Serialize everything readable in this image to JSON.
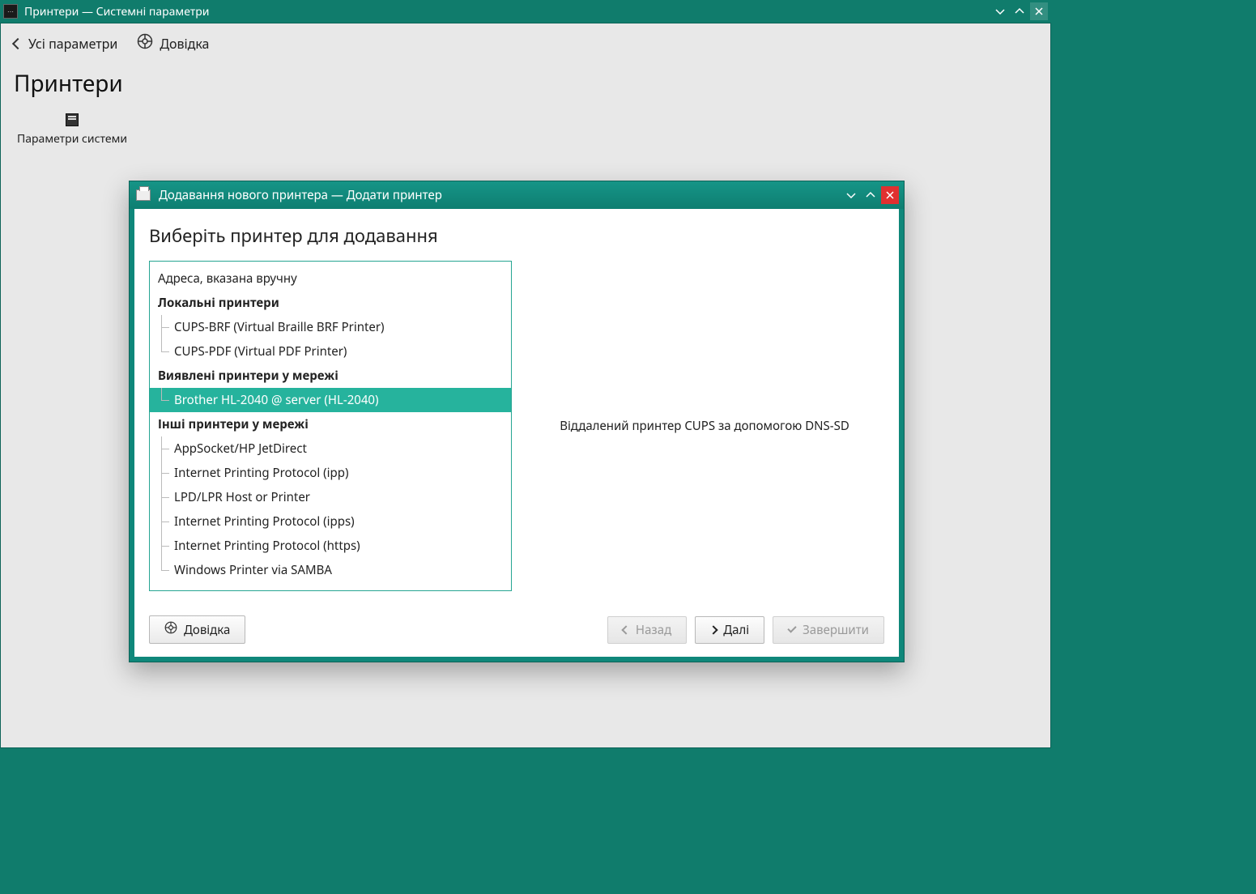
{
  "main_window": {
    "title": "Принтери — Системні параметри"
  },
  "toolbar": {
    "back_label": "Усі параметри",
    "help_label": "Довідка"
  },
  "page": {
    "title": "Принтери",
    "kcm_label": "Параметри системи"
  },
  "dialog": {
    "title": "Додавання нового принтера — Додати принтер",
    "heading": "Виберіть принтер для додавання",
    "detail_text": "Віддалений принтер CUPS за допомогою DNS-SD",
    "footer": {
      "help": "Довідка",
      "back": "Назад",
      "next": "Далі",
      "finish": "Завершити"
    },
    "tree": {
      "manual": "Адреса, вказана вручну",
      "local_header": "Локальні принтери",
      "local": [
        "CUPS-BRF (Virtual Braille BRF Printer)",
        "CUPS-PDF (Virtual PDF Printer)"
      ],
      "discovered_header": "Виявлені принтери у мережі",
      "discovered": [
        "Brother HL-2040 @ server (HL-2040)"
      ],
      "other_header": "Інші принтери у мережі",
      "other": [
        "AppSocket/HP JetDirect",
        "Internet Printing Protocol (ipp)",
        "LPD/LPR Host or Printer",
        "Internet Printing Protocol (ipps)",
        "Internet Printing Protocol (https)",
        "Windows Printer via SAMBA"
      ]
    }
  }
}
